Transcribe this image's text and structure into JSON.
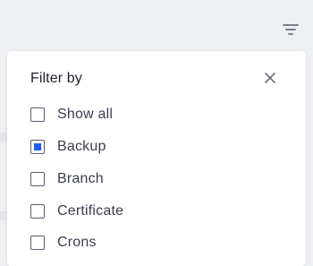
{
  "filter_toggle": {
    "icon": "filter-lines-icon"
  },
  "panel": {
    "title": "Filter by",
    "close_icon": "close-icon",
    "options": [
      {
        "label": "Show all",
        "checked": false
      },
      {
        "label": "Backup",
        "checked": true
      },
      {
        "label": "Branch",
        "checked": false
      },
      {
        "label": "Certificate",
        "checked": false
      },
      {
        "label": "Crons",
        "checked": false
      }
    ]
  },
  "colors": {
    "accent": "#1d5cf0",
    "text": "#3a3d4d",
    "title": "#1f1f2b",
    "icon": "#6b6f7e",
    "background": "#eef0f3",
    "panel": "#ffffff"
  }
}
